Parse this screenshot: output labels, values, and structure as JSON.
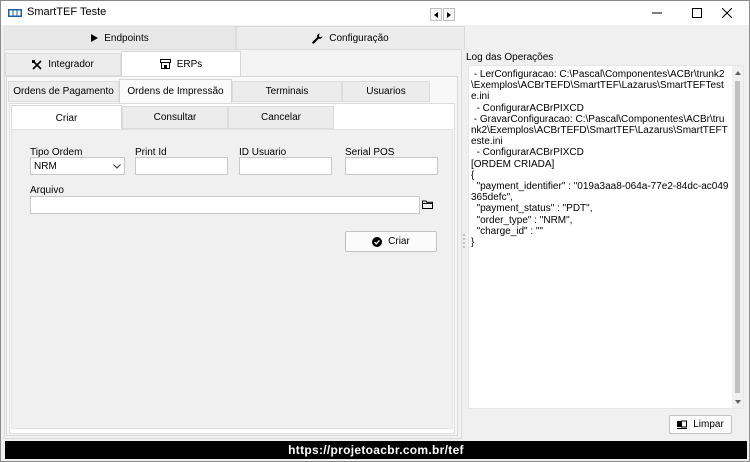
{
  "window": {
    "title": "SmartTEF Teste"
  },
  "main_tabs": [
    {
      "label": "Endpoints",
      "icon": "play-icon",
      "active": false
    },
    {
      "label": "Configuração",
      "icon": "wrench-icon",
      "active": true
    }
  ],
  "sub_tabs": [
    {
      "label": "Integrador",
      "icon": "tools-icon",
      "active": false
    },
    {
      "label": "ERPs",
      "icon": "store-icon",
      "active": true
    }
  ],
  "erp_tabs": [
    {
      "label": "Ordens de Pagamento",
      "active": false
    },
    {
      "label": "Ordens de Impressão",
      "active": true
    },
    {
      "label": "Terminais",
      "active": false
    },
    {
      "label": "Usuarios",
      "active": false
    }
  ],
  "action_tabs": [
    {
      "label": "Criar",
      "active": true
    },
    {
      "label": "Consultar",
      "active": false
    },
    {
      "label": "Cancelar",
      "active": false
    }
  ],
  "form": {
    "tipo_ordem_label": "Tipo Ordem",
    "tipo_ordem_value": "NRM",
    "print_id_label": "Print Id",
    "print_id_value": "",
    "id_usuario_label": "ID Usuario",
    "id_usuario_value": "",
    "serial_pos_label": "Serial POS",
    "serial_pos_value": "",
    "arquivo_label": "Arquivo",
    "arquivo_value": "",
    "criar_button": "Criar"
  },
  "log": {
    "title": "Log das Operações",
    "content": " - LerConfiguracao: C:\\Pascal\\Componentes\\ACBr\\trunk2\\Exemplos\\ACBrTEFD\\SmartTEF\\Lazarus\\SmartTEFTeste.ini\n  - ConfigurarACBrPIXCD\n - GravarConfiguracao: C:\\Pascal\\Componentes\\ACBr\\trunk2\\Exemplos\\ACBrTEFD\\SmartTEF\\Lazarus\\SmartTEFTeste.ini\n  - ConfigurarACBrPIXCD\n[ORDEM CRIADA]\n{\n  \"payment_identifier\" : \"019a3aa8-064a-77e2-84dc-ac049365defc\",\n  \"payment_status\" : \"PDT\",\n  \"order_type\" : \"NRM\",\n  \"charge_id\" : \"\"\n}",
    "limpar_button": "Limpar"
  },
  "footer": {
    "url": "https://projetoacbr.com.br/tef"
  }
}
